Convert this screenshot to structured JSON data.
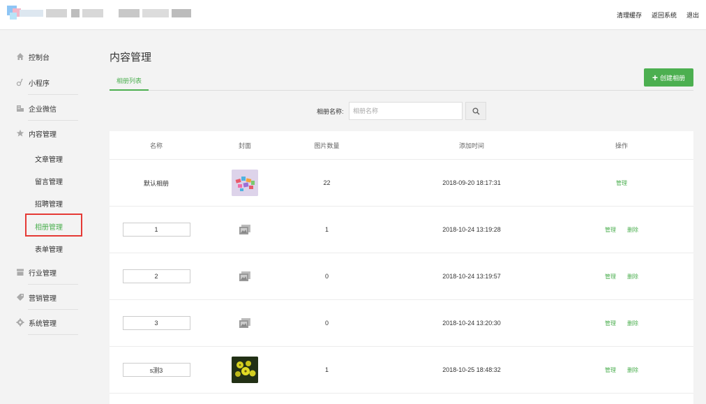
{
  "header": {
    "links": [
      "清理缓存",
      "返回系统",
      "退出"
    ]
  },
  "sidebar": {
    "items": [
      {
        "label": "控制台",
        "icon": "home-icon"
      },
      {
        "label": "小程序",
        "icon": "link-icon"
      },
      {
        "label": "企业微信",
        "icon": "building-icon"
      },
      {
        "label": "内容管理",
        "icon": "star-icon"
      },
      {
        "label": "行业管理",
        "icon": "store-icon"
      },
      {
        "label": "营销管理",
        "icon": "tag-icon"
      },
      {
        "label": "系统管理",
        "icon": "gear-icon"
      }
    ],
    "sub_items": [
      "文章管理",
      "留言管理",
      "招聘管理",
      "相册管理",
      "表单管理"
    ],
    "active_sub": "相册管理"
  },
  "main": {
    "title": "内容管理",
    "tab": "相册列表",
    "create_button": "创建相册",
    "search": {
      "label": "相册名称:",
      "placeholder": "相册名称",
      "value": ""
    }
  },
  "table": {
    "columns": [
      "名称",
      "封面",
      "图片数量",
      "添加时间",
      "操作"
    ],
    "rows": [
      {
        "name": "默认相册",
        "editable": false,
        "cover": "colorful",
        "count": "22",
        "time": "2018-09-20 18:17:31",
        "ops": [
          "管理"
        ]
      },
      {
        "name": "1",
        "editable": true,
        "cover": "default",
        "count": "1",
        "time": "2018-10-24 13:19:28",
        "ops": [
          "管理",
          "删除"
        ]
      },
      {
        "name": "2",
        "editable": true,
        "cover": "default",
        "count": "0",
        "time": "2018-10-24 13:19:57",
        "ops": [
          "管理",
          "删除"
        ]
      },
      {
        "name": "3",
        "editable": true,
        "cover": "default",
        "count": "0",
        "time": "2018-10-24 13:20:30",
        "ops": [
          "管理",
          "删除"
        ]
      },
      {
        "name": "s测3",
        "editable": true,
        "cover": "flowers",
        "count": "1",
        "time": "2018-10-25 18:48:32",
        "ops": [
          "管理",
          "删除"
        ]
      }
    ]
  },
  "colors": {
    "accent": "#4caf50",
    "highlight": "#e53935"
  }
}
